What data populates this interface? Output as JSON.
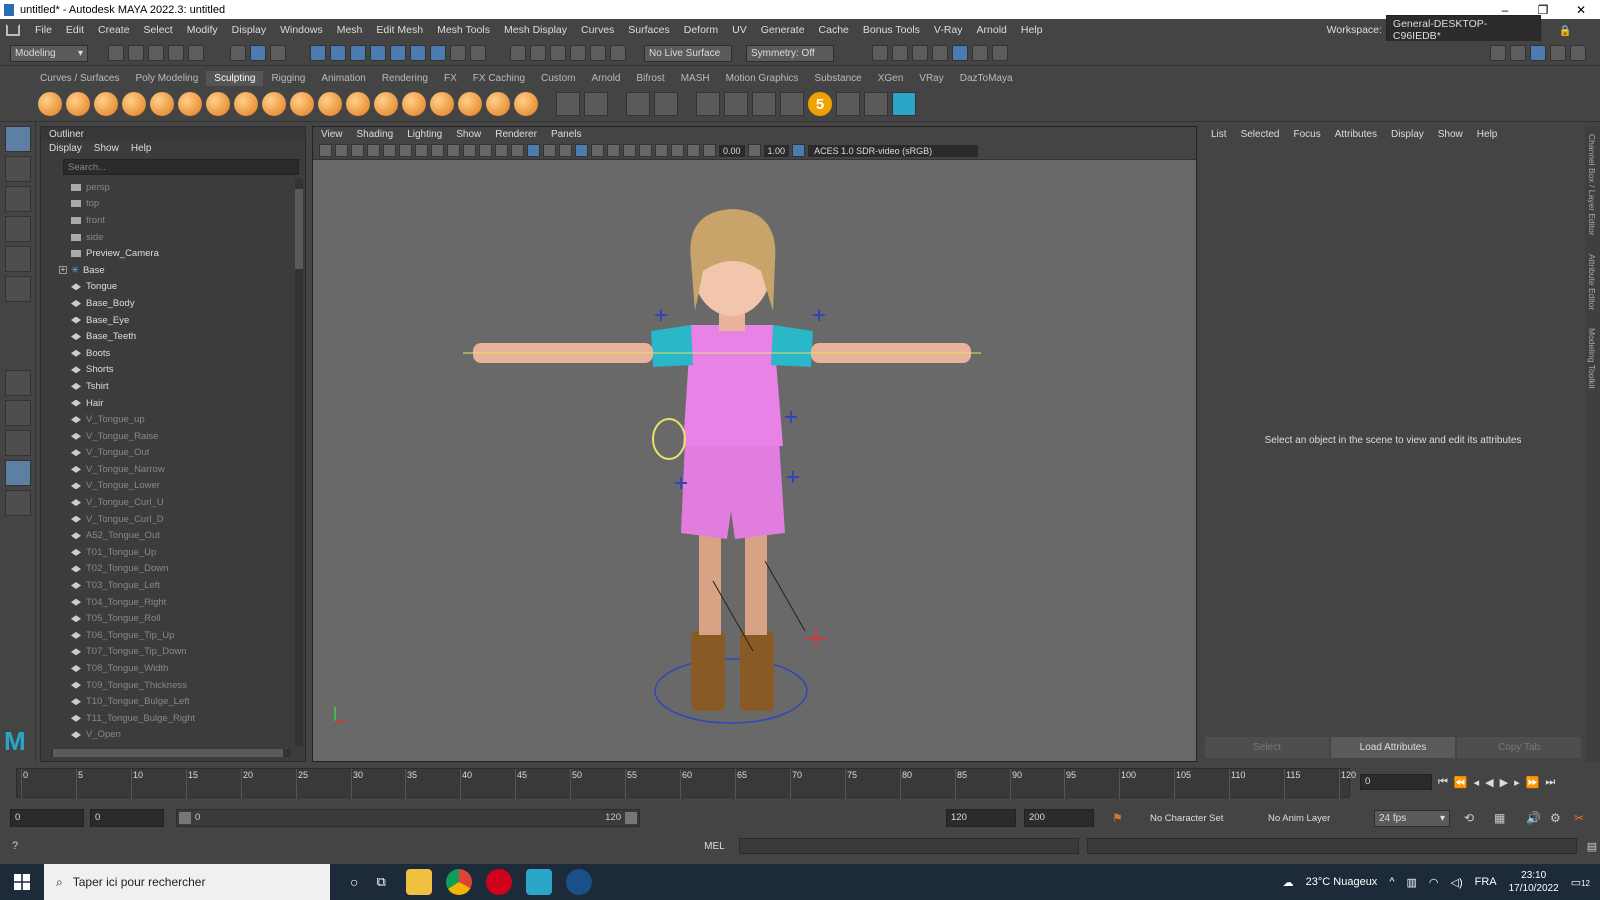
{
  "window": {
    "title": "untitled* - Autodesk MAYA 2022.3: untitled"
  },
  "menu": [
    "File",
    "Edit",
    "Create",
    "Select",
    "Modify",
    "Display",
    "Windows",
    "Mesh",
    "Edit Mesh",
    "Mesh Tools",
    "Mesh Display",
    "Curves",
    "Surfaces",
    "Deform",
    "UV",
    "Generate",
    "Cache",
    "Bonus Tools",
    "V-Ray",
    "Arnold",
    "Help"
  ],
  "workspace": {
    "label": "Workspace:",
    "value": "General-DESKTOP-C96IEDB*"
  },
  "statusline": {
    "mode": "Modeling",
    "live_surface": "No Live Surface",
    "symmetry": "Symmetry: Off"
  },
  "shelf_tabs": [
    "Curves / Surfaces",
    "Poly Modeling",
    "Sculpting",
    "Rigging",
    "Animation",
    "Rendering",
    "FX",
    "FX Caching",
    "Custom",
    "Arnold",
    "Bifrost",
    "MASH",
    "Motion Graphics",
    "Substance",
    "XGen",
    "VRay",
    "DazToMaya"
  ],
  "shelf_active": "Sculpting",
  "outliner": {
    "title": "Outliner",
    "menu": [
      "Display",
      "Show",
      "Help"
    ],
    "search_placeholder": "Search...",
    "items": [
      {
        "label": "persp",
        "kind": "camera",
        "dim": true
      },
      {
        "label": "top",
        "kind": "camera",
        "dim": true
      },
      {
        "label": "front",
        "kind": "camera",
        "dim": true
      },
      {
        "label": "side",
        "kind": "camera",
        "dim": true
      },
      {
        "label": "Preview_Camera",
        "kind": "camera",
        "dim": false
      },
      {
        "label": "Base",
        "kind": "joint",
        "dim": false,
        "expand": true
      },
      {
        "label": "Tongue",
        "kind": "mesh",
        "dim": false
      },
      {
        "label": "Base_Body",
        "kind": "mesh",
        "dim": false
      },
      {
        "label": "Base_Eye",
        "kind": "mesh",
        "dim": false
      },
      {
        "label": "Base_Teeth",
        "kind": "mesh",
        "dim": false
      },
      {
        "label": "Boots",
        "kind": "mesh",
        "dim": false
      },
      {
        "label": "Shorts",
        "kind": "mesh",
        "dim": false
      },
      {
        "label": "Tshirt",
        "kind": "mesh",
        "dim": false
      },
      {
        "label": "Hair",
        "kind": "mesh",
        "dim": false
      },
      {
        "label": "V_Tongue_up",
        "kind": "mesh",
        "dim": true
      },
      {
        "label": "V_Tongue_Raise",
        "kind": "mesh",
        "dim": true
      },
      {
        "label": "V_Tongue_Out",
        "kind": "mesh",
        "dim": true
      },
      {
        "label": "V_Tongue_Narrow",
        "kind": "mesh",
        "dim": true
      },
      {
        "label": "V_Tongue_Lower",
        "kind": "mesh",
        "dim": true
      },
      {
        "label": "V_Tongue_Curl_U",
        "kind": "mesh",
        "dim": true
      },
      {
        "label": "V_Tongue_Curl_D",
        "kind": "mesh",
        "dim": true
      },
      {
        "label": "A52_Tongue_Out",
        "kind": "mesh",
        "dim": true
      },
      {
        "label": "T01_Tongue_Up",
        "kind": "mesh",
        "dim": true
      },
      {
        "label": "T02_Tongue_Down",
        "kind": "mesh",
        "dim": true
      },
      {
        "label": "T03_Tongue_Left",
        "kind": "mesh",
        "dim": true
      },
      {
        "label": "T04_Tongue_Right",
        "kind": "mesh",
        "dim": true
      },
      {
        "label": "T05_Tongue_Roll",
        "kind": "mesh",
        "dim": true
      },
      {
        "label": "T06_Tongue_Tip_Up",
        "kind": "mesh",
        "dim": true
      },
      {
        "label": "T07_Tongue_Tip_Down",
        "kind": "mesh",
        "dim": true
      },
      {
        "label": "T08_Tongue_Width",
        "kind": "mesh",
        "dim": true
      },
      {
        "label": "T09_Tongue_Thickness",
        "kind": "mesh",
        "dim": true
      },
      {
        "label": "T10_Tongue_Bulge_Left",
        "kind": "mesh",
        "dim": true
      },
      {
        "label": "T11_Tongue_Bulge_Right",
        "kind": "mesh",
        "dim": true
      },
      {
        "label": "V_Open",
        "kind": "mesh",
        "dim": true
      }
    ]
  },
  "viewport": {
    "menu": [
      "View",
      "Shading",
      "Lighting",
      "Show",
      "Renderer",
      "Panels"
    ],
    "exposure": "0.00",
    "gamma": "1.00",
    "color_space": "ACES 1.0 SDR-video (sRGB)"
  },
  "attribute_editor": {
    "menu": [
      "List",
      "Selected",
      "Focus",
      "Attributes",
      "Display",
      "Show",
      "Help"
    ],
    "message": "Select an object in the scene to view and edit its attributes",
    "buttons": [
      "Select",
      "Load Attributes",
      "Copy Tab"
    ]
  },
  "side_tabs": [
    "Channel Box / Layer Editor",
    "Attribute Editor",
    "Modeling Toolkit"
  ],
  "timeline": {
    "ticks": [
      "0",
      "5",
      "10",
      "15",
      "20",
      "25",
      "30",
      "35",
      "40",
      "45",
      "50",
      "55",
      "60",
      "65",
      "70",
      "75",
      "80",
      "85",
      "90",
      "95",
      "100",
      "105",
      "110",
      "115",
      "120"
    ],
    "current_frame": "0"
  },
  "range": {
    "start": "0",
    "playback_start": "0",
    "slider_start": "0",
    "slider_end": "120",
    "playback_end": "120",
    "end": "200",
    "character_set": "No Character Set",
    "anim_layer": "No Anim Layer",
    "fps": "24 fps"
  },
  "command_line": {
    "lang": "MEL"
  },
  "taskbar": {
    "search": "Taper ici pour rechercher",
    "weather": "23°C  Nuageux",
    "lang": "FRA",
    "time": "23:10",
    "date": "17/10/2022",
    "notifications": "12"
  }
}
